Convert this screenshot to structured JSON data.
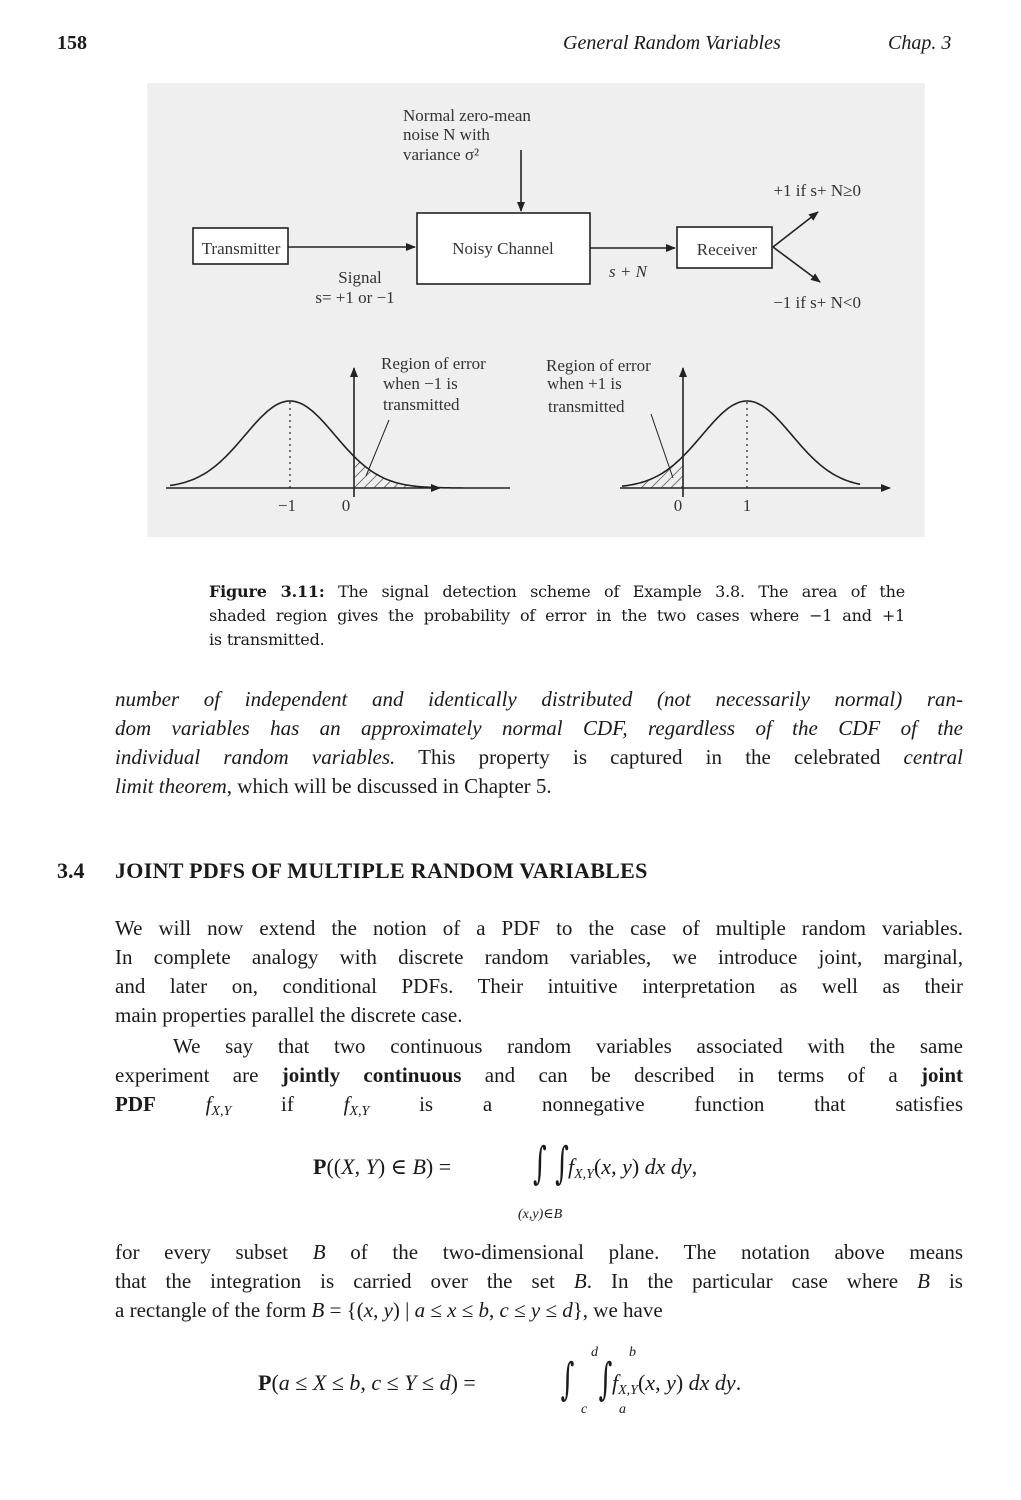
{
  "header": {
    "page_number": "158",
    "running_title": "General Random Variables",
    "chapter": "Chap. 3"
  },
  "figure": {
    "noise_label": [
      "Normal zero-mean",
      "noise N with",
      "variance σ²"
    ],
    "transmitter": "Transmitter",
    "channel": "Noisy Channel",
    "receiver": "Receiver",
    "signal_label": "Signal",
    "signal_values": "s= +1 or −1",
    "channel_output": "s + N",
    "decision_plus": "+1 if s+ N≥0",
    "decision_minus": "−1 if s+ N<0",
    "left_plot": {
      "label": [
        "Region of error",
        "when −1 is",
        "transmitted"
      ],
      "ticks": [
        "−1",
        "0"
      ]
    },
    "right_plot": {
      "label": [
        "Region of error",
        "when +1 is",
        "transmitted"
      ],
      "ticks": [
        "0",
        "1"
      ]
    },
    "caption": [
      [
        {
          "t": "Figure 3.11:",
          "f": "b"
        },
        {
          "t": " The signal detection scheme of Example 3.8. The area of the",
          "f": ""
        }
      ],
      [
        {
          "t": "shaded region gives the probability of error in the two cases where −1 and +1",
          "f": ""
        }
      ],
      [
        {
          "t": "is transmitted.",
          "f": ""
        }
      ]
    ]
  },
  "body": {
    "para1": [
      [
        {
          "t": "number of independent and identically distributed (not necessarily normal) ran-",
          "f": "i"
        }
      ],
      [
        {
          "t": "dom variables has an approximately normal CDF, regardless of the CDF of the",
          "f": "i"
        }
      ],
      [
        {
          "t": "individual random variables.",
          "f": "i"
        },
        {
          "t": " This property is captured in the celebrated ",
          "f": ""
        },
        {
          "t": "central",
          "f": "i"
        }
      ],
      [
        {
          "t": "limit theorem",
          "f": "i"
        },
        {
          "t": ", which will be discussed in Chapter 5.",
          "f": ""
        }
      ]
    ],
    "section_number": "3.4",
    "section_title": "JOINT PDFS OF MULTIPLE RANDOM VARIABLES",
    "para2": [
      [
        {
          "t": "We will now extend the notion of a PDF to the case of multiple random variables.",
          "f": ""
        }
      ],
      [
        {
          "t": "In complete analogy with discrete random variables, we introduce joint, marginal,",
          "f": ""
        }
      ],
      [
        {
          "t": "and later on, conditional PDFs. Their intuitive interpretation as well as their",
          "f": ""
        }
      ],
      [
        {
          "t": "main properties parallel the discrete case.",
          "f": ""
        }
      ]
    ],
    "para3": [
      [
        {
          "t": "We say that two continuous random variables associated with the same",
          "f": ""
        }
      ],
      [
        {
          "t": "experiment are ",
          "f": ""
        },
        {
          "t": "jointly continuous",
          "f": "b"
        },
        {
          "t": " and can be described in terms of a ",
          "f": ""
        },
        {
          "t": "joint",
          "f": "b"
        }
      ],
      [
        {
          "t": "PDF",
          "f": "b"
        },
        {
          "t": " f",
          "f": "m"
        },
        {
          "t": "X,Y",
          "f": "sub"
        },
        {
          "t": " if ",
          "f": ""
        },
        {
          "t": "f",
          "f": "m"
        },
        {
          "t": "X,Y",
          "f": "sub"
        },
        {
          "t": " is a nonnegative function that satisfies",
          "f": ""
        }
      ]
    ],
    "eq1": {
      "lhs": [
        {
          "t": "P",
          "f": "b"
        },
        {
          "t": "((",
          "f": ""
        },
        {
          "t": "X",
          "f": "m"
        },
        {
          "t": ", ",
          "f": ""
        },
        {
          "t": "Y",
          "f": "m"
        },
        {
          "t": ") ∈ ",
          "f": ""
        },
        {
          "t": "B",
          "f": "m"
        },
        {
          "t": ") =",
          "f": ""
        }
      ],
      "integral": "∫ ∫",
      "domain": "(x,y)∈B",
      "rhs": [
        {
          "t": "f",
          "f": "m"
        },
        {
          "t": "X,Y",
          "f": "sub"
        },
        {
          "t": "(",
          "f": ""
        },
        {
          "t": "x",
          "f": "m"
        },
        {
          "t": ", ",
          "f": ""
        },
        {
          "t": "y",
          "f": "m"
        },
        {
          "t": ") ",
          "f": ""
        },
        {
          "t": "dx dy",
          "f": "m"
        },
        {
          "t": ",",
          "f": ""
        }
      ]
    },
    "para4": [
      [
        {
          "t": "for every subset ",
          "f": ""
        },
        {
          "t": "B",
          "f": "m"
        },
        {
          "t": " of the two-dimensional plane.  The notation above means",
          "f": ""
        }
      ],
      [
        {
          "t": "that the integration is carried over the set ",
          "f": ""
        },
        {
          "t": "B",
          "f": "m"
        },
        {
          "t": ". In the particular case where ",
          "f": ""
        },
        {
          "t": "B",
          "f": "m"
        },
        {
          "t": " is",
          "f": ""
        }
      ],
      [
        {
          "t": "a rectangle of the form ",
          "f": ""
        },
        {
          "t": "B",
          "f": "m"
        },
        {
          "t": " = {(",
          "f": ""
        },
        {
          "t": "x",
          "f": "m"
        },
        {
          "t": ", ",
          "f": ""
        },
        {
          "t": "y",
          "f": "m"
        },
        {
          "t": ") | ",
          "f": ""
        },
        {
          "t": "a",
          "f": "m"
        },
        {
          "t": " ≤ ",
          "f": ""
        },
        {
          "t": "x",
          "f": "m"
        },
        {
          "t": " ≤ ",
          "f": ""
        },
        {
          "t": "b",
          "f": "m"
        },
        {
          "t": ",  ",
          "f": ""
        },
        {
          "t": "c",
          "f": "m"
        },
        {
          "t": " ≤ ",
          "f": ""
        },
        {
          "t": "y",
          "f": "m"
        },
        {
          "t": " ≤ ",
          "f": ""
        },
        {
          "t": "d",
          "f": "m"
        },
        {
          "t": "}, we have",
          "f": ""
        }
      ]
    ],
    "eq2": {
      "lhs": [
        {
          "t": "P",
          "f": "b"
        },
        {
          "t": "(",
          "f": ""
        },
        {
          "t": "a",
          "f": "m"
        },
        {
          "t": " ≤ ",
          "f": ""
        },
        {
          "t": "X",
          "f": "m"
        },
        {
          "t": " ≤ ",
          "f": ""
        },
        {
          "t": "b",
          "f": "m"
        },
        {
          "t": ", ",
          "f": ""
        },
        {
          "t": "c",
          "f": "m"
        },
        {
          "t": " ≤ ",
          "f": ""
        },
        {
          "t": "Y",
          "f": "m"
        },
        {
          "t": " ≤ ",
          "f": ""
        },
        {
          "t": "d",
          "f": "m"
        },
        {
          "t": ") =",
          "f": ""
        }
      ],
      "integral": "∫",
      "outer_upper": "d",
      "outer_lower": "c",
      "inner_upper": "b",
      "inner_lower": "a",
      "rhs": [
        {
          "t": "f",
          "f": "m"
        },
        {
          "t": "X,Y",
          "f": "sub"
        },
        {
          "t": "(",
          "f": ""
        },
        {
          "t": "x",
          "f": "m"
        },
        {
          "t": ", ",
          "f": ""
        },
        {
          "t": "y",
          "f": "m"
        },
        {
          "t": ") ",
          "f": ""
        },
        {
          "t": "dx dy",
          "f": "m"
        },
        {
          "t": ".",
          "f": ""
        }
      ]
    }
  }
}
